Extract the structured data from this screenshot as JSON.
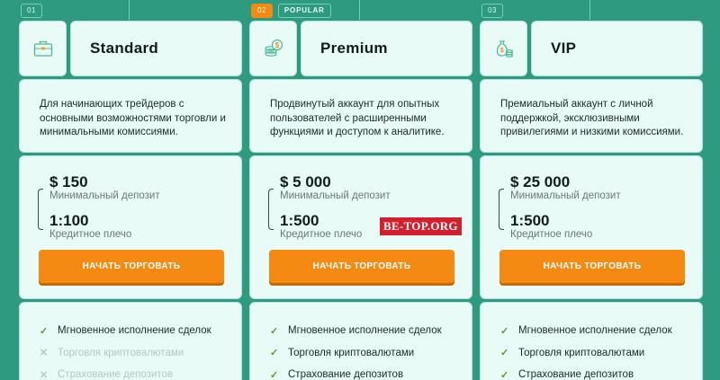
{
  "plans": [
    {
      "number": "01",
      "badge": "",
      "icon": "briefcase-icon",
      "name": "Standard",
      "description": "Для начинающих трейдеров с основными возможностями торговли и минимальными комиссиями.",
      "deposit_value": "$ 150",
      "deposit_label": "Минимальный депозит",
      "leverage_value": "1:100",
      "leverage_label": "Кредитное плечо",
      "button_label": "НАЧАТЬ ТОРГОВАТЬ",
      "features": [
        {
          "text": "Мгновенное исполнение сделок",
          "included": true
        },
        {
          "text": "Торговля криптовалютами",
          "included": false
        },
        {
          "text": "Страхование депозитов",
          "included": false
        }
      ]
    },
    {
      "number": "02",
      "badge": "POPULAR",
      "icon": "coins-stack-icon",
      "name": "Premium",
      "description": "Продвинутый аккаунт для опытных пользователей с расширенными функциями и доступом к аналитике.",
      "deposit_value": "$ 5 000",
      "deposit_label": "Минимальный депозит",
      "leverage_value": "1:500",
      "leverage_label": "Кредитное плечо",
      "button_label": "НАЧАТЬ ТОРГОВАТЬ",
      "features": [
        {
          "text": "Мгновенное исполнение сделок",
          "included": true
        },
        {
          "text": "Торговля криптовалютами",
          "included": true
        },
        {
          "text": "Страхование депозитов",
          "included": true
        }
      ]
    },
    {
      "number": "03",
      "badge": "",
      "icon": "money-bag-icon",
      "name": "VIP",
      "description": "Премиальный аккаунт с личной поддержкой, эксклюзивными привилегиями и низкими комиссиями.",
      "deposit_value": "$ 25 000",
      "deposit_label": "Минимальный депозит",
      "leverage_value": "1:500",
      "leverage_label": "Кредитное плечо",
      "button_label": "НАЧАТЬ ТОРГОВАТЬ",
      "features": [
        {
          "text": "Мгновенное исполнение сделок",
          "included": true
        },
        {
          "text": "Торговля криптовалютами",
          "included": true
        },
        {
          "text": "Страхование депозитов",
          "included": true
        }
      ]
    }
  ],
  "marks": {
    "included": "✓",
    "excluded": "✕"
  },
  "watermark": "BE-TOP.ORG",
  "colors": {
    "background": "#2e9a80",
    "card": "#e8fbf6",
    "accent": "#f48a12",
    "check": "#5f9a1e"
  }
}
